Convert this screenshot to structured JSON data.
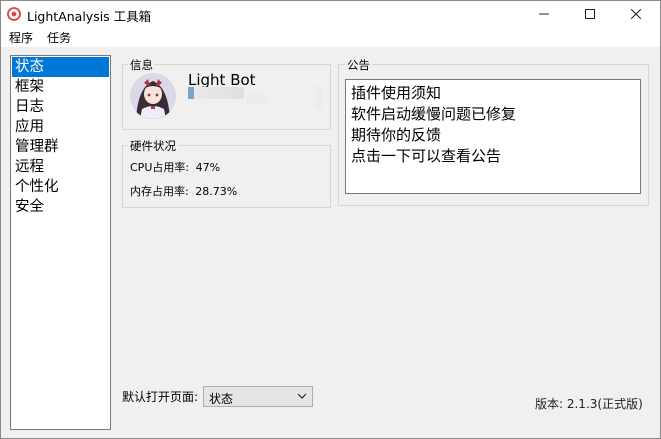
{
  "window": {
    "title": "LightAnalysis 工具箱"
  },
  "menu": [
    {
      "label": "程序"
    },
    {
      "label": "任务"
    }
  ],
  "nav": {
    "items": [
      {
        "label": "状态",
        "selected": true
      },
      {
        "label": "框架"
      },
      {
        "label": "日志"
      },
      {
        "label": "应用"
      },
      {
        "label": "管理群"
      },
      {
        "label": "远程"
      },
      {
        "label": "个性化"
      },
      {
        "label": "安全"
      }
    ]
  },
  "info": {
    "title": "信息",
    "bot_name": "Light Bot"
  },
  "hardware": {
    "title": "硬件状况",
    "cpu_label": "CPU占用率:",
    "cpu_value": "47%",
    "mem_label": "内存占用率:",
    "mem_value": "28.73%"
  },
  "notice": {
    "title": "公告",
    "lines": [
      "插件使用须知",
      "软件启动缓慢问题已修复",
      "期待你的反馈",
      "点击一下可以查看公告"
    ]
  },
  "settings": {
    "default_page_label": "默认打开页面:",
    "default_page_value": "状态"
  },
  "version": "版本: 2.1.3(正式版)",
  "colors": {
    "selection": "#0078d7",
    "window_bg": "#f0f0f0"
  }
}
